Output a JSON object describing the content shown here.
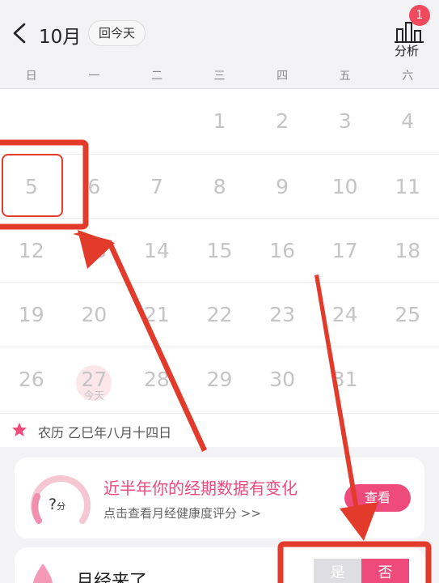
{
  "header": {
    "month": "10月",
    "today_button": "回今天",
    "analysis_label": "分析",
    "badge_count": "1"
  },
  "weekdays": [
    "日",
    "一",
    "二",
    "三",
    "四",
    "五",
    "六"
  ],
  "calendar": {
    "weeks": [
      [
        "",
        "",
        "",
        "1",
        "2",
        "3",
        "4"
      ],
      [
        "5",
        "6",
        "7",
        "8",
        "9",
        "10",
        "11"
      ],
      [
        "12",
        "13",
        "14",
        "15",
        "16",
        "17",
        "18"
      ],
      [
        "19",
        "20",
        "21",
        "22",
        "23",
        "24",
        "25"
      ],
      [
        "26",
        "27",
        "28",
        "29",
        "30",
        "31",
        ""
      ]
    ],
    "today_date": "27",
    "today_label": "今天"
  },
  "lunar": {
    "text": "农历 乙巳年八月十四日"
  },
  "health_card": {
    "score": "?",
    "score_unit": "分",
    "title": "近半年你的经期数据有变化",
    "subtitle": "点击查看月经健康度评分 >>",
    "button": "查看"
  },
  "period_card": {
    "title": "月经来了",
    "yes": "是",
    "no": "否"
  },
  "colors": {
    "accent": "#ef4a7c",
    "annotation_red": "#e33b2b",
    "badge": "#ef4a5d"
  }
}
